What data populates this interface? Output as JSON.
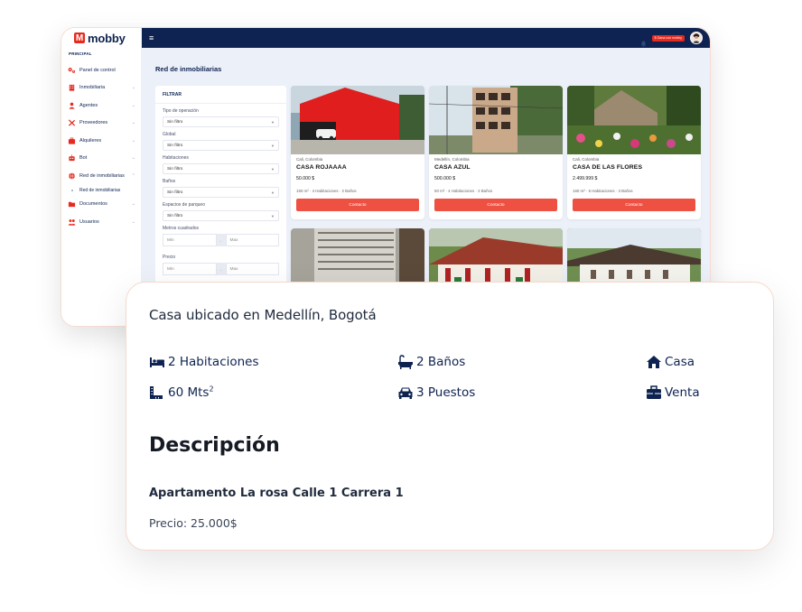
{
  "brand": {
    "logo_letter": "M",
    "name": "mobby"
  },
  "sidebar": {
    "section_label": "PRINCIPAL",
    "items": [
      {
        "label": "Panel de control",
        "icon": "cogs-icon",
        "chevron": ""
      },
      {
        "label": "Inmobiliaria",
        "icon": "building-icon",
        "chevron": "⌄"
      },
      {
        "label": "Agentes",
        "icon": "user-icon",
        "chevron": "⌄"
      },
      {
        "label": "Proveedores",
        "icon": "tools-icon",
        "chevron": "⌄"
      },
      {
        "label": "Alquileres",
        "icon": "briefcase-icon",
        "chevron": "⌄"
      },
      {
        "label": "Bot",
        "icon": "robot-icon",
        "chevron": "⌄"
      },
      {
        "label": "Red de inmobiliarias",
        "icon": "globe-icon",
        "chevron": "⌃"
      },
      {
        "label": "Documentos",
        "icon": "folder-icon",
        "chevron": "⌄"
      },
      {
        "label": "Usuarios",
        "icon": "users-icon",
        "chevron": "⌄"
      }
    ],
    "sub_item": "Red de inmobiliarias"
  },
  "topbar": {
    "menu_icon": "≡",
    "chip_label": "$ Gana con mobby"
  },
  "main": {
    "title": "Red de inmobiliarias"
  },
  "filter": {
    "heading": "FILTRAR",
    "selects": [
      {
        "label": "Tipo de operación",
        "value": "Sin filtro"
      },
      {
        "label": "Global",
        "value": "Sin filtro"
      },
      {
        "label": "Habitaciones",
        "value": "Sin filtro"
      },
      {
        "label": "Baños",
        "value": "Sin filtro"
      },
      {
        "label": "Espacios de parqueo",
        "value": "Sin filtro"
      }
    ],
    "ranges": [
      {
        "label": "Metros cuadrados",
        "min": "Min",
        "max": "Max",
        "sep": "-"
      },
      {
        "label": "Precio",
        "min": "Min",
        "max": "Max",
        "sep": "-"
      }
    ]
  },
  "cards": [
    {
      "location": "Cali, Colombia",
      "title": "CASA ROJAAAA",
      "price": "50.000 $",
      "meta": "150 m² · 4 Habitaciones · 2 Baños",
      "button": "Contacto"
    },
    {
      "location": "Medellín, Colombia",
      "title": "CASA AZUL",
      "price": "500.000 $",
      "meta": "50 m² · 4 Habitaciones · 2 Baños",
      "button": "Contacto"
    },
    {
      "location": "Cali, Colombia",
      "title": "CASA DE LAS FLORES",
      "price": "2.499.999 $",
      "meta": "160 m² · 6 Habitaciones · 3 Baños",
      "button": "Contacto"
    }
  ],
  "detail": {
    "location": "Casa ubicado en Medellín, Bogotá",
    "features": {
      "rooms": "2 Habitaciones",
      "baths": "2 Baños",
      "type": "Casa",
      "area": "60 Mts",
      "area_sup": "2",
      "parking": "3 Puestos",
      "operation": "Venta"
    },
    "heading": "Descripción",
    "subtitle": "Apartamento La rosa Calle 1 Carrera 1",
    "price": "Precio: 25.000$"
  },
  "colors": {
    "navy": "#0e2351",
    "accent": "#ee5042",
    "brand_red": "#e52b20",
    "main_bg": "#ecf0f9"
  }
}
